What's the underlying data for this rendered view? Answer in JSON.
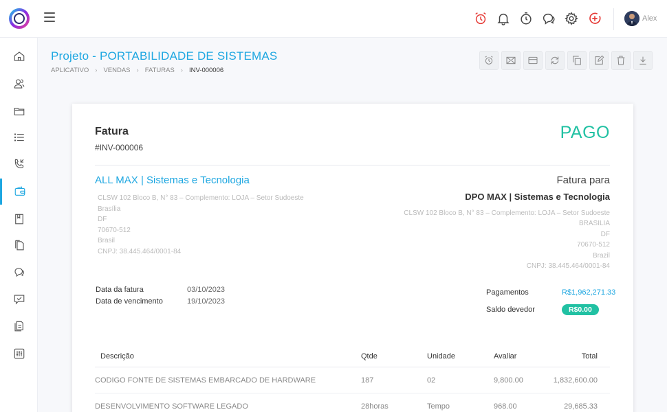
{
  "topbar": {
    "user": {
      "name": "Alex"
    },
    "icons": [
      "alarm-icon",
      "bell-icon",
      "timer-icon",
      "chat-icon",
      "gear-icon",
      "add-icon"
    ],
    "alarm_color": "#e53935",
    "add_color": "#e53935"
  },
  "page": {
    "title": "Projeto - PORTABILIDADE DE SISTEMAS",
    "breadcrumb": [
      "APLICATIVO",
      "VENDAS",
      "FATURAS",
      "INV-000006"
    ]
  },
  "sidebar": {
    "items": [
      "home-icon",
      "users-icon",
      "folder-icon",
      "list-icon",
      "phone-icon",
      "wallet-icon",
      "book-icon",
      "documents-icon",
      "chat-icon",
      "support-icon",
      "files-icon",
      "settings-sliders-icon"
    ],
    "active_index": 5,
    "accent": "#1ea7e1"
  },
  "actions": [
    "alarm-icon",
    "mail-icon",
    "card-icon",
    "refresh-icon",
    "copy-icon",
    "edit-icon",
    "trash-icon",
    "download-icon"
  ],
  "invoice": {
    "heading": "Fatura",
    "number": "#INV-000006",
    "status": "PAGO",
    "status_color": "#21c1a3",
    "from": {
      "name": "ALL MAX | Sistemas e Tecnologia",
      "address": [
        "CLSW 102 Bloco B, N° 83 – Complemento: LOJA – Setor Sudoeste",
        "Brasília",
        "DF",
        "70670-512",
        "Brasil",
        "CNPJ: 38.445.464/0001-84"
      ]
    },
    "to": {
      "heading": "Fatura para",
      "name": "DPO MAX | Sistemas e Tecnologia",
      "address": [
        "CLSW 102 Bloco B, N° 83 – Complemento: LOJA – Setor Sudoeste",
        "BRASILIA",
        "DF",
        "70670-512",
        "Brazil",
        "CNPJ: 38.445.464/0001-84"
      ]
    },
    "dates": {
      "invoice_date_label": "Data da fatura",
      "invoice_date": "03/10/2023",
      "due_date_label": "Data de vencimento",
      "due_date": "19/10/2023"
    },
    "payments": {
      "payments_label": "Pagamentos",
      "payments_value": "R$1,962,271.33",
      "balance_label": "Saldo devedor",
      "balance_value": "R$0.00"
    },
    "table": {
      "headers": [
        "Descrição",
        "Qtde",
        "Unidade",
        "Avaliar",
        "Total"
      ],
      "rows": [
        [
          "CODIGO FONTE DE SISTEMAS EMBARCADO DE HARDWARE",
          "187",
          "02",
          "9,800.00",
          "1,832,600.00"
        ],
        [
          "DESENVOLVIMENTO SOFTWARE LEGADO",
          "28horas",
          "Tempo",
          "968.00",
          "29,685.33"
        ]
      ]
    }
  }
}
